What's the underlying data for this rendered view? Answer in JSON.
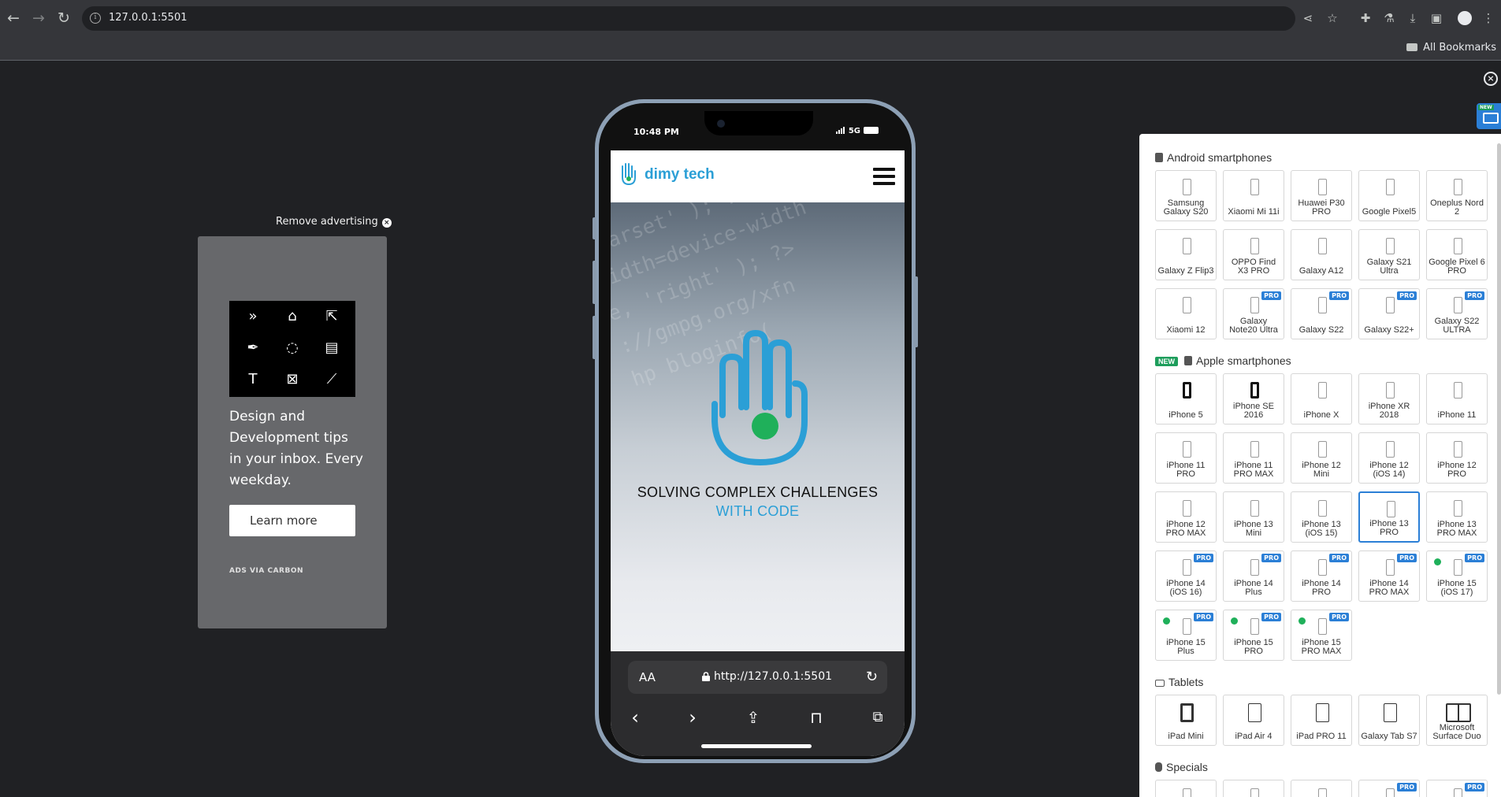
{
  "browser": {
    "url": "127.0.0.1:5501",
    "bookmarks_label": "All Bookmarks"
  },
  "ad": {
    "remove_label": "Remove advertising",
    "text": "Design and Development tips in your inbox. Every weekday.",
    "button_label": "Learn more",
    "via": "ADS VIA CARBON"
  },
  "phone": {
    "time": "10:48 PM",
    "network": "5G",
    "site": {
      "brand": "dimy tech",
      "hero_title": "SOLVING COMPLEX CHALLENGES",
      "hero_subtitle": "WITH CODE"
    },
    "safari": {
      "aa": "AA",
      "address": "http://127.0.0.1:5501"
    }
  },
  "panel": {
    "android_title": "Android smartphones",
    "apple_new_tag": "NEW",
    "apple_title": "Apple smartphones",
    "tablets_title": "Tablets",
    "specials_title": "Specials",
    "pro_badge": "PRO",
    "android": [
      {
        "label": "Samsung Galaxy S20"
      },
      {
        "label": "Xiaomi Mi 11i"
      },
      {
        "label": "Huawei P30 PRO"
      },
      {
        "label": "Google Pixel5"
      },
      {
        "label": "Oneplus Nord 2"
      },
      {
        "label": "Galaxy Z Flip3"
      },
      {
        "label": "OPPO Find X3 PRO"
      },
      {
        "label": "Galaxy A12"
      },
      {
        "label": "Galaxy S21 Ultra"
      },
      {
        "label": "Google Pixel 6 PRO"
      },
      {
        "label": "Xiaomi 12"
      },
      {
        "label": "Galaxy Note20 Ultra",
        "pro": true
      },
      {
        "label": "Galaxy S22",
        "pro": true
      },
      {
        "label": "Galaxy S22+",
        "pro": true
      },
      {
        "label": "Galaxy S22 ULTRA",
        "pro": true
      }
    ],
    "apple": [
      {
        "label": "iPhone 5",
        "dark": true
      },
      {
        "label": "iPhone SE 2016",
        "dark": true
      },
      {
        "label": "iPhone X"
      },
      {
        "label": "iPhone XR 2018"
      },
      {
        "label": "iPhone 11"
      },
      {
        "label": "iPhone 11 PRO"
      },
      {
        "label": "iPhone 11 PRO MAX"
      },
      {
        "label": "iPhone 12 Mini"
      },
      {
        "label": "iPhone 12 (iOS 14)"
      },
      {
        "label": "iPhone 12 PRO"
      },
      {
        "label": "iPhone 12 PRO MAX"
      },
      {
        "label": "iPhone 13 Mini"
      },
      {
        "label": "iPhone 13 (iOS 15)"
      },
      {
        "label": "iPhone 13 PRO",
        "selected": true
      },
      {
        "label": "iPhone 13 PRO MAX"
      },
      {
        "label": "iPhone 14 (iOS 16)",
        "pro": true
      },
      {
        "label": "iPhone 14 Plus",
        "pro": true
      },
      {
        "label": "iPhone 14 PRO",
        "pro": true
      },
      {
        "label": "iPhone 14 PRO MAX",
        "pro": true
      },
      {
        "label": "iPhone 15 (iOS 17)",
        "pro": true,
        "dot": true
      },
      {
        "label": "iPhone 15 Plus",
        "pro": true,
        "dot": true
      },
      {
        "label": "iPhone 15 PRO",
        "pro": true,
        "dot": true
      },
      {
        "label": "iPhone 15 PRO MAX",
        "pro": true,
        "dot": true
      }
    ],
    "tablets": [
      {
        "label": "iPad Mini",
        "icon": "tablet-dark-icon"
      },
      {
        "label": "iPad Air 4",
        "icon": "tablet-icon"
      },
      {
        "label": "iPad PRO 11",
        "icon": "tablet-icon"
      },
      {
        "label": "Galaxy Tab S7",
        "icon": "tablet-icon"
      },
      {
        "label": "Microsoft Surface Duo",
        "icon": "dual-screen-icon"
      }
    ],
    "specials": [
      {
        "label": ""
      },
      {
        "label": ""
      },
      {
        "label": ""
      },
      {
        "label": "",
        "pro": true
      },
      {
        "label": "",
        "pro": true
      }
    ]
  },
  "colors": {
    "page_bg": "#202124",
    "accent_blue": "#2b7fd6",
    "brand_blue": "#2b9fd6",
    "new_green": "#1e9e5c",
    "dot_green": "#1fb05a"
  }
}
